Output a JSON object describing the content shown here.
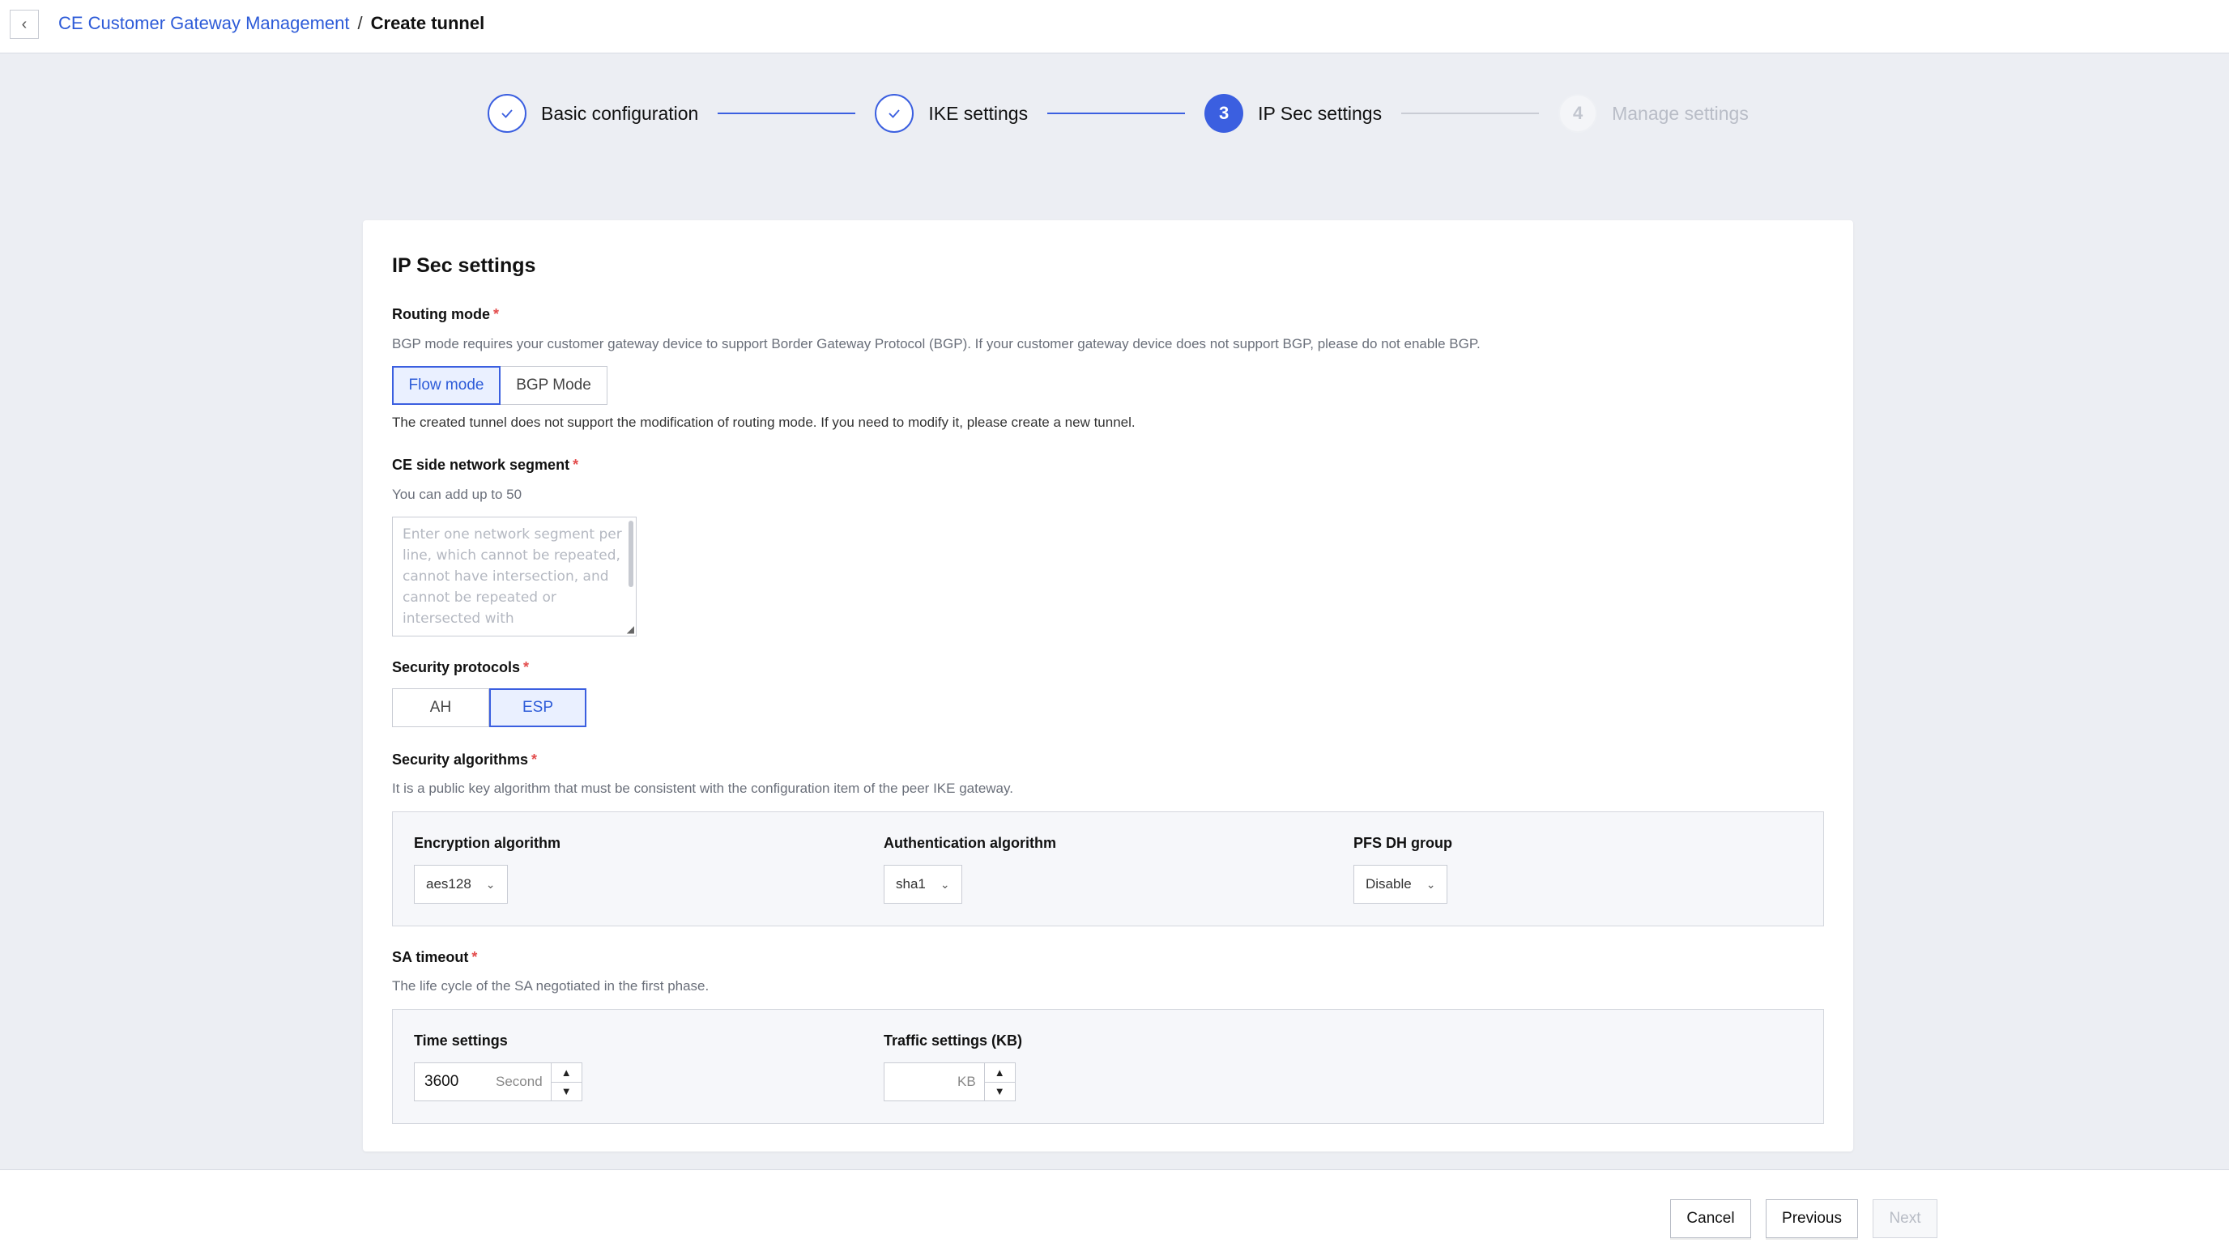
{
  "header": {
    "back_icon": "chevron-left-icon",
    "breadcrumb_parent": "CE Customer Gateway Management",
    "breadcrumb_separator": "/",
    "breadcrumb_current": "Create tunnel"
  },
  "steps": [
    {
      "number": "1",
      "label": "Basic configuration",
      "state": "done"
    },
    {
      "number": "2",
      "label": "IKE settings",
      "state": "done"
    },
    {
      "number": "3",
      "label": "IP Sec settings",
      "state": "active"
    },
    {
      "number": "4",
      "label": "Manage settings",
      "state": "todo"
    }
  ],
  "form": {
    "title": "IP Sec settings",
    "routing_mode": {
      "label": "Routing mode",
      "required": "*",
      "hint": "BGP mode requires your customer gateway device to support Border Gateway Protocol (BGP). If your customer gateway device does not support BGP, please do not enable BGP.",
      "options": [
        "Flow mode",
        "BGP Mode"
      ],
      "selected": "Flow mode",
      "note": "The created tunnel does not support the modification of routing mode. If you need to modify it, please create a new tunnel."
    },
    "ce_segment": {
      "label": "CE side network segment",
      "required": "*",
      "hint": "You can add up to 50",
      "placeholder": "Enter one network segment per line, which cannot be repeated, cannot have intersection, and cannot be repeated or intersected with"
    },
    "security_protocols": {
      "label": "Security protocols",
      "required": "*",
      "options": [
        "AH",
        "ESP"
      ],
      "selected": "ESP"
    },
    "security_algorithms": {
      "label": "Security algorithms",
      "required": "*",
      "hint": "It is a public key algorithm that must be consistent with the configuration item of the peer IKE gateway.",
      "encryption": {
        "label": "Encryption algorithm",
        "value": "aes128"
      },
      "authentication": {
        "label": "Authentication algorithm",
        "value": "sha1"
      },
      "pfs": {
        "label": "PFS DH group",
        "value": "Disable"
      }
    },
    "sa_timeout": {
      "label": "SA timeout",
      "required": "*",
      "hint": "The life cycle of the SA negotiated in the first phase.",
      "time": {
        "label": "Time settings",
        "value": "3600",
        "unit": "Second"
      },
      "traffic": {
        "label": "Traffic settings (KB)",
        "value": "",
        "unit": "KB"
      }
    }
  },
  "footer": {
    "cancel": "Cancel",
    "previous": "Previous",
    "next": "Next"
  },
  "colors": {
    "accent": "#3b5fe0",
    "link": "#2d5bd8",
    "required": "#e34d4d"
  }
}
